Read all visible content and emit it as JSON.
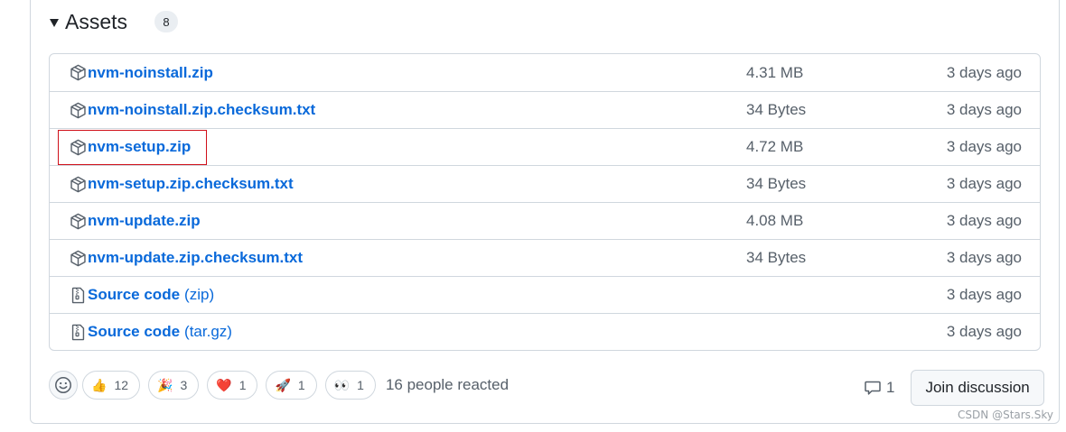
{
  "assets": {
    "title": "Assets",
    "count": "8",
    "items": [
      {
        "name": "nvm-noinstall.zip",
        "suffix": "",
        "size": "4.31 MB",
        "time": "3 days ago",
        "icon": "package-icon"
      },
      {
        "name": "nvm-noinstall.zip.checksum.txt",
        "suffix": "",
        "size": "34 Bytes",
        "time": "3 days ago",
        "icon": "package-icon"
      },
      {
        "name": "nvm-setup.zip",
        "suffix": "",
        "size": "4.72 MB",
        "time": "3 days ago",
        "icon": "package-icon"
      },
      {
        "name": "nvm-setup.zip.checksum.txt",
        "suffix": "",
        "size": "34 Bytes",
        "time": "3 days ago",
        "icon": "package-icon"
      },
      {
        "name": "nvm-update.zip",
        "suffix": "",
        "size": "4.08 MB",
        "time": "3 days ago",
        "icon": "package-icon"
      },
      {
        "name": "nvm-update.zip.checksum.txt",
        "suffix": "",
        "size": "34 Bytes",
        "time": "3 days ago",
        "icon": "package-icon"
      },
      {
        "name": "Source code",
        "suffix": "(zip)",
        "size": "",
        "time": "3 days ago",
        "icon": "file-zip-icon"
      },
      {
        "name": "Source code",
        "suffix": "(tar.gz)",
        "size": "",
        "time": "3 days ago",
        "icon": "file-zip-icon"
      }
    ]
  },
  "reactions": {
    "items": [
      {
        "emoji": "👍",
        "count": "12",
        "icon": "thumbs-up-icon"
      },
      {
        "emoji": "🎉",
        "count": "3",
        "icon": "party-popper-icon"
      },
      {
        "emoji": "❤️",
        "count": "1",
        "icon": "heart-icon"
      },
      {
        "emoji": "🚀",
        "count": "1",
        "icon": "rocket-icon"
      },
      {
        "emoji": "👀",
        "count": "1",
        "icon": "eyes-icon"
      }
    ],
    "summary": "16 people reacted"
  },
  "discussion": {
    "comment_count": "1",
    "button_label": "Join discussion"
  },
  "watermark": "CSDN @Stars.Sky",
  "colors": {
    "link": "#0969da",
    "muted": "#57606a",
    "border": "#d0d7de",
    "highlight": "#d0101a"
  }
}
